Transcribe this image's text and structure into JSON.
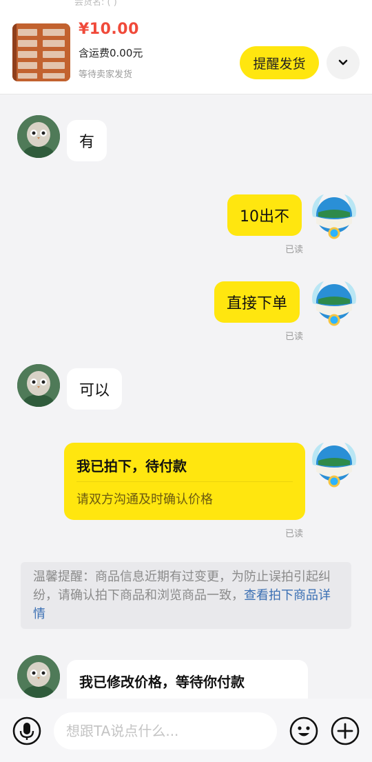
{
  "header": {
    "ghost_text": "尝货名: ( )",
    "price": "¥10.00",
    "shipping": "含运费0.00元",
    "status": "等待卖家发货",
    "remind_label": "提醒发货"
  },
  "messages": {
    "m1": "有",
    "m2": "10出不",
    "m2_read": "已读",
    "m3": "直接下单",
    "m3_read": "已读",
    "m4": "可以",
    "m5_title": "我已拍下，待付款",
    "m5_sub": "请双方沟通及时确认价格",
    "m5_read": "已读",
    "notice_text": "温馨提醒：商品信息近期有过变更，为防止误拍引起纠纷，请确认拍下商品和浏览商品一致，",
    "notice_link": "查看拍下商品详情",
    "m6_title": "我已修改价格，等待你付款"
  },
  "input": {
    "placeholder": "想跟TA说点什么..."
  },
  "icons": {
    "mic": "mic-icon",
    "emoji": "emoji-icon",
    "plus": "plus-icon",
    "chevron": "chevron-down-icon"
  },
  "colors": {
    "accent": "#ffe60f",
    "price": "#f04a3a",
    "link": "#3a6fb3"
  }
}
